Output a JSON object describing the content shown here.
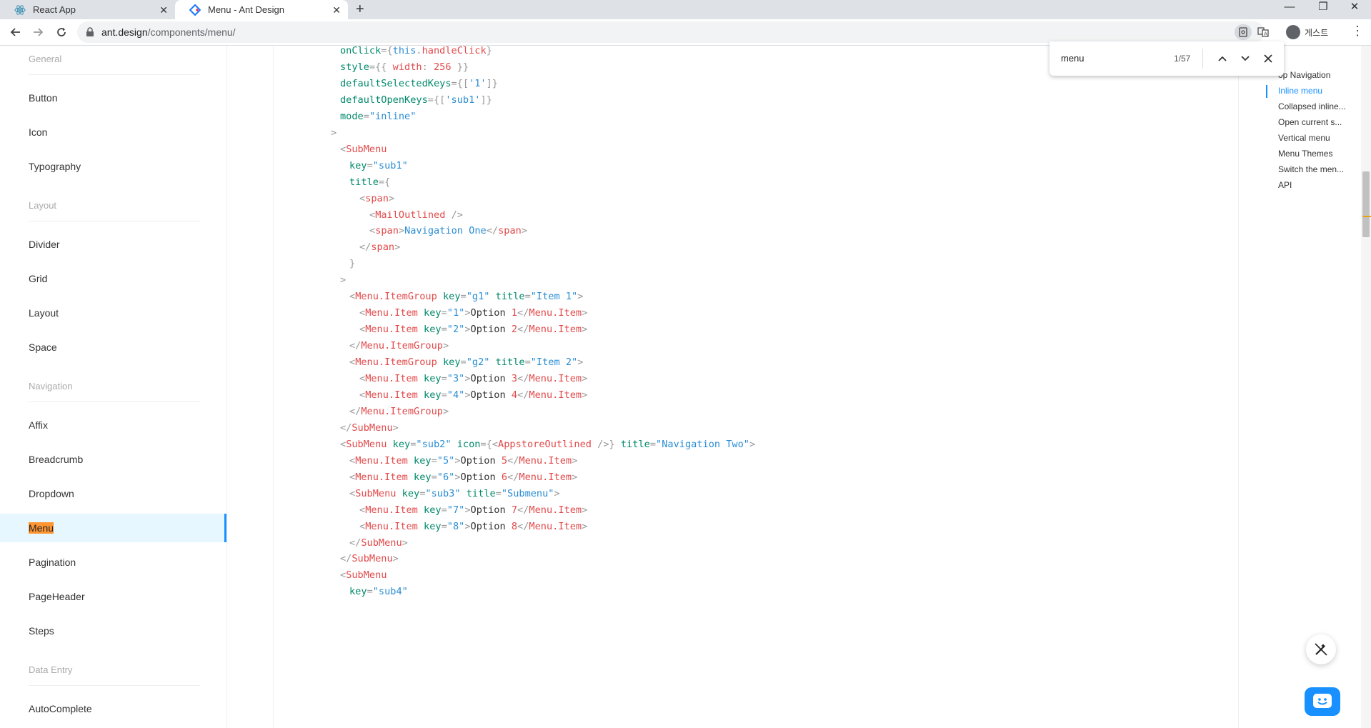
{
  "browser": {
    "tabs": [
      {
        "title": "React App",
        "icon": "react-icon"
      },
      {
        "title": "Menu - Ant Design",
        "icon": "ant-design-icon"
      }
    ],
    "url_host": "ant.design",
    "url_path": "/components/menu/",
    "profile_label": "게스트"
  },
  "find": {
    "query": "menu",
    "count": "1/57"
  },
  "sidebar": {
    "groups": [
      "General",
      "Layout",
      "Navigation",
      "Data Entry"
    ],
    "items": [
      "Button",
      "Icon",
      "Typography",
      "Divider",
      "Grid",
      "Layout",
      "Space",
      "Affix",
      "Breadcrumb",
      "Dropdown",
      "Menu",
      "Pagination",
      "PageHeader",
      "Steps",
      "AutoComplete"
    ],
    "active": "Menu"
  },
  "anchors": [
    "op Navigation",
    "Inline menu",
    "Collapsed inline...",
    "Open current s...",
    "Vertical menu",
    "Menu Themes",
    "Switch the men...",
    "API"
  ],
  "code_lines": [
    [
      [
        "a",
        "onClick"
      ],
      [
        "p",
        "={"
      ],
      [
        "s",
        "this"
      ],
      [
        "p",
        "."
      ],
      [
        "t",
        "handleClick"
      ],
      [
        "p",
        "}"
      ]
    ],
    [
      [
        "a",
        "style"
      ],
      [
        "p",
        "={{ "
      ],
      [
        "t",
        "width"
      ],
      [
        "p",
        ": "
      ],
      [
        "n",
        "256"
      ],
      [
        "p",
        " }}"
      ]
    ],
    [
      [
        "a",
        "defaultSelectedKeys"
      ],
      [
        "p",
        "={["
      ],
      [
        "s",
        "'1'"
      ],
      [
        "p",
        "]}"
      ]
    ],
    [
      [
        "a",
        "defaultOpenKeys"
      ],
      [
        "p",
        "={["
      ],
      [
        "s",
        "'sub1'"
      ],
      [
        "p",
        "]}"
      ]
    ],
    [
      [
        "a",
        "mode"
      ],
      [
        "p",
        "="
      ],
      [
        "s",
        "\"inline\""
      ]
    ],
    [
      [
        "p",
        ">"
      ]
    ],
    [
      [
        "p",
        "<"
      ],
      [
        "t",
        "SubMenu"
      ]
    ],
    [
      [
        "a",
        "key"
      ],
      [
        "p",
        "="
      ],
      [
        "s",
        "\"sub1\""
      ]
    ],
    [
      [
        "a",
        "title"
      ],
      [
        "p",
        "={"
      ]
    ],
    [
      [
        "p",
        "<"
      ],
      [
        "t",
        "span"
      ],
      [
        "p",
        ">"
      ]
    ],
    [
      [
        "p",
        "<"
      ],
      [
        "t",
        "MailOutlined"
      ],
      [
        "p",
        " />"
      ]
    ],
    [
      [
        "p",
        "<"
      ],
      [
        "t",
        "span"
      ],
      [
        "p",
        ">"
      ],
      [
        "s",
        "Navigation One"
      ],
      [
        "p",
        "</"
      ],
      [
        "t",
        "span"
      ],
      [
        "p",
        ">"
      ]
    ],
    [
      [
        "p",
        "</"
      ],
      [
        "t",
        "span"
      ],
      [
        "p",
        ">"
      ]
    ],
    [
      [
        "p",
        "}"
      ]
    ],
    [
      [
        "p",
        ">"
      ]
    ],
    [
      [
        "p",
        "<"
      ],
      [
        "t",
        "Menu.ItemGroup"
      ],
      [
        "x",
        " "
      ],
      [
        "a",
        "key"
      ],
      [
        "p",
        "="
      ],
      [
        "s",
        "\"g1\""
      ],
      [
        "x",
        " "
      ],
      [
        "a",
        "title"
      ],
      [
        "p",
        "="
      ],
      [
        "s",
        "\"Item 1\""
      ],
      [
        "p",
        ">"
      ]
    ],
    [
      [
        "p",
        "<"
      ],
      [
        "t",
        "Menu.Item"
      ],
      [
        "x",
        " "
      ],
      [
        "a",
        "key"
      ],
      [
        "p",
        "="
      ],
      [
        "s",
        "\"1\""
      ],
      [
        "p",
        ">"
      ],
      [
        "x",
        "Option "
      ],
      [
        "n",
        "1"
      ],
      [
        "p",
        "</"
      ],
      [
        "t",
        "Menu.Item"
      ],
      [
        "p",
        ">"
      ]
    ],
    [
      [
        "p",
        "<"
      ],
      [
        "t",
        "Menu.Item"
      ],
      [
        "x",
        " "
      ],
      [
        "a",
        "key"
      ],
      [
        "p",
        "="
      ],
      [
        "s",
        "\"2\""
      ],
      [
        "p",
        ">"
      ],
      [
        "x",
        "Option "
      ],
      [
        "n",
        "2"
      ],
      [
        "p",
        "</"
      ],
      [
        "t",
        "Menu.Item"
      ],
      [
        "p",
        ">"
      ]
    ],
    [
      [
        "p",
        "</"
      ],
      [
        "t",
        "Menu.ItemGroup"
      ],
      [
        "p",
        ">"
      ]
    ],
    [
      [
        "p",
        "<"
      ],
      [
        "t",
        "Menu.ItemGroup"
      ],
      [
        "x",
        " "
      ],
      [
        "a",
        "key"
      ],
      [
        "p",
        "="
      ],
      [
        "s",
        "\"g2\""
      ],
      [
        "x",
        " "
      ],
      [
        "a",
        "title"
      ],
      [
        "p",
        "="
      ],
      [
        "s",
        "\"Item 2\""
      ],
      [
        "p",
        ">"
      ]
    ],
    [
      [
        "p",
        "<"
      ],
      [
        "t",
        "Menu.Item"
      ],
      [
        "x",
        " "
      ],
      [
        "a",
        "key"
      ],
      [
        "p",
        "="
      ],
      [
        "s",
        "\"3\""
      ],
      [
        "p",
        ">"
      ],
      [
        "x",
        "Option "
      ],
      [
        "n",
        "3"
      ],
      [
        "p",
        "</"
      ],
      [
        "t",
        "Menu.Item"
      ],
      [
        "p",
        ">"
      ]
    ],
    [
      [
        "p",
        "<"
      ],
      [
        "t",
        "Menu.Item"
      ],
      [
        "x",
        " "
      ],
      [
        "a",
        "key"
      ],
      [
        "p",
        "="
      ],
      [
        "s",
        "\"4\""
      ],
      [
        "p",
        ">"
      ],
      [
        "x",
        "Option "
      ],
      [
        "n",
        "4"
      ],
      [
        "p",
        "</"
      ],
      [
        "t",
        "Menu.Item"
      ],
      [
        "p",
        ">"
      ]
    ],
    [
      [
        "p",
        "</"
      ],
      [
        "t",
        "Menu.ItemGroup"
      ],
      [
        "p",
        ">"
      ]
    ],
    [
      [
        "p",
        "</"
      ],
      [
        "t",
        "SubMenu"
      ],
      [
        "p",
        ">"
      ]
    ],
    [
      [
        "p",
        "<"
      ],
      [
        "t",
        "SubMenu"
      ],
      [
        "x",
        " "
      ],
      [
        "a",
        "key"
      ],
      [
        "p",
        "="
      ],
      [
        "s",
        "\"sub2\""
      ],
      [
        "x",
        " "
      ],
      [
        "a",
        "icon"
      ],
      [
        "p",
        "={<"
      ],
      [
        "t",
        "AppstoreOutlined"
      ],
      [
        "p",
        " />}"
      ],
      [
        "x",
        " "
      ],
      [
        "a",
        "title"
      ],
      [
        "p",
        "="
      ],
      [
        "s",
        "\"Navigation Two\""
      ],
      [
        "p",
        ">"
      ]
    ],
    [
      [
        "p",
        "<"
      ],
      [
        "t",
        "Menu.Item"
      ],
      [
        "x",
        " "
      ],
      [
        "a",
        "key"
      ],
      [
        "p",
        "="
      ],
      [
        "s",
        "\"5\""
      ],
      [
        "p",
        ">"
      ],
      [
        "x",
        "Option "
      ],
      [
        "n",
        "5"
      ],
      [
        "p",
        "</"
      ],
      [
        "t",
        "Menu.Item"
      ],
      [
        "p",
        ">"
      ]
    ],
    [
      [
        "p",
        "<"
      ],
      [
        "t",
        "Menu.Item"
      ],
      [
        "x",
        " "
      ],
      [
        "a",
        "key"
      ],
      [
        "p",
        "="
      ],
      [
        "s",
        "\"6\""
      ],
      [
        "p",
        ">"
      ],
      [
        "x",
        "Option "
      ],
      [
        "n",
        "6"
      ],
      [
        "p",
        "</"
      ],
      [
        "t",
        "Menu.Item"
      ],
      [
        "p",
        ">"
      ]
    ],
    [
      [
        "p",
        "<"
      ],
      [
        "t",
        "SubMenu"
      ],
      [
        "x",
        " "
      ],
      [
        "a",
        "key"
      ],
      [
        "p",
        "="
      ],
      [
        "s",
        "\"sub3\""
      ],
      [
        "x",
        " "
      ],
      [
        "a",
        "title"
      ],
      [
        "p",
        "="
      ],
      [
        "s",
        "\"Submenu\""
      ],
      [
        "p",
        ">"
      ]
    ],
    [
      [
        "p",
        "<"
      ],
      [
        "t",
        "Menu.Item"
      ],
      [
        "x",
        " "
      ],
      [
        "a",
        "key"
      ],
      [
        "p",
        "="
      ],
      [
        "s",
        "\"7\""
      ],
      [
        "p",
        ">"
      ],
      [
        "x",
        "Option "
      ],
      [
        "n",
        "7"
      ],
      [
        "p",
        "</"
      ],
      [
        "t",
        "Menu.Item"
      ],
      [
        "p",
        ">"
      ]
    ],
    [
      [
        "p",
        "<"
      ],
      [
        "t",
        "Menu.Item"
      ],
      [
        "x",
        " "
      ],
      [
        "a",
        "key"
      ],
      [
        "p",
        "="
      ],
      [
        "s",
        "\"8\""
      ],
      [
        "p",
        ">"
      ],
      [
        "x",
        "Option "
      ],
      [
        "n",
        "8"
      ],
      [
        "p",
        "</"
      ],
      [
        "t",
        "Menu.Item"
      ],
      [
        "p",
        ">"
      ]
    ],
    [
      [
        "p",
        "</"
      ],
      [
        "t",
        "SubMenu"
      ],
      [
        "p",
        ">"
      ]
    ],
    [
      [
        "p",
        "</"
      ],
      [
        "t",
        "SubMenu"
      ],
      [
        "p",
        ">"
      ]
    ],
    [
      [
        "p",
        "<"
      ],
      [
        "t",
        "SubMenu"
      ]
    ],
    [
      [
        "a",
        "key"
      ],
      [
        "p",
        "="
      ],
      [
        "s",
        "\"sub4\""
      ]
    ]
  ]
}
